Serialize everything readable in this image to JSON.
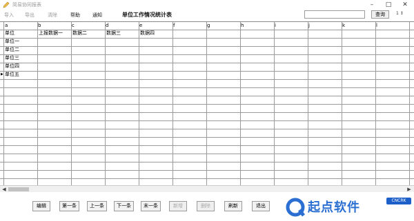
{
  "window": {
    "title": "简易协同报表"
  },
  "menu": [
    {
      "label": "导入",
      "state": "dim"
    },
    {
      "label": "导出",
      "state": "dim"
    },
    {
      "label": "清除",
      "state": "dim"
    },
    {
      "label": "帮助",
      "state": "strong"
    },
    {
      "label": "通知",
      "state": "strong"
    }
  ],
  "report_title": "单位工作情况统计表",
  "search": {
    "value": "",
    "button_label": "查询",
    "page_indicator": "1 ↕"
  },
  "grid": {
    "column_headers": [
      "a",
      "b",
      "c",
      "d",
      "e",
      "f",
      "g",
      "h",
      "i",
      "j",
      "k",
      "l"
    ],
    "header_row": [
      "单位",
      "上报数据一",
      "数据二",
      "数据三",
      "数据四",
      "",
      "",
      "",
      "",
      "",
      "",
      ""
    ],
    "row_labels": [
      "单位一",
      "单位二",
      "单位三",
      "单位四",
      "单位五"
    ],
    "current_row_marker": "▶"
  },
  "buttons": [
    {
      "label": "编辑",
      "enabled": true
    },
    {
      "label": "第一条",
      "enabled": true
    },
    {
      "label": "上一条",
      "enabled": true
    },
    {
      "label": "下一条",
      "enabled": true
    },
    {
      "label": "末一条",
      "enabled": true
    },
    {
      "label": "新增",
      "enabled": false
    },
    {
      "label": "删除",
      "enabled": false
    },
    {
      "label": "刷新",
      "enabled": true
    },
    {
      "label": "退出",
      "enabled": true
    }
  ],
  "watermark": {
    "text": "起点软件",
    "badge": "CNCRK"
  }
}
